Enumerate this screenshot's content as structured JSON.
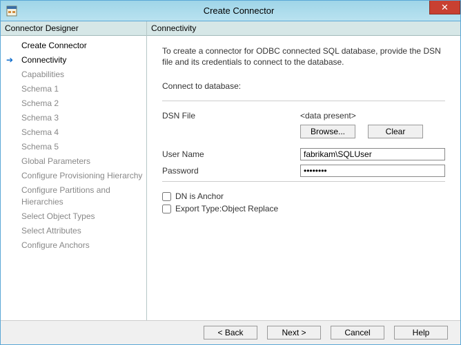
{
  "window": {
    "title": "Create Connector",
    "close_label": "✕"
  },
  "left_header": "Connector Designer",
  "right_header": "Connectivity",
  "nav": {
    "items": [
      {
        "label": "Create Connector",
        "state": "visited"
      },
      {
        "label": "Connectivity",
        "state": "current"
      },
      {
        "label": "Capabilities",
        "state": "future"
      },
      {
        "label": "Schema 1",
        "state": "future"
      },
      {
        "label": "Schema 2",
        "state": "future"
      },
      {
        "label": "Schema 3",
        "state": "future"
      },
      {
        "label": "Schema 4",
        "state": "future"
      },
      {
        "label": "Schema 5",
        "state": "future"
      },
      {
        "label": "Global Parameters",
        "state": "future"
      },
      {
        "label": "Configure Provisioning Hierarchy",
        "state": "future"
      },
      {
        "label": "Configure Partitions and Hierarchies",
        "state": "future"
      },
      {
        "label": "Select Object Types",
        "state": "future"
      },
      {
        "label": "Select Attributes",
        "state": "future"
      },
      {
        "label": "Configure Anchors",
        "state": "future"
      }
    ]
  },
  "description": "To create a connector for ODBC connected SQL database, provide the DSN file and its credentials to connect to the database.",
  "connect_header": "Connect to database:",
  "fields": {
    "dsn_label": "DSN File",
    "dsn_value": "<data present>",
    "browse_label": "Browse...",
    "clear_label": "Clear",
    "user_label": "User Name",
    "user_value": "fabrikam\\SQLUser",
    "password_label": "Password",
    "password_value": "••••••••"
  },
  "checks": {
    "dn_anchor": "DN is Anchor",
    "export_type": "Export Type:Object Replace"
  },
  "footer": {
    "back": "<  Back",
    "next": "Next  >",
    "cancel": "Cancel",
    "help": "Help"
  }
}
